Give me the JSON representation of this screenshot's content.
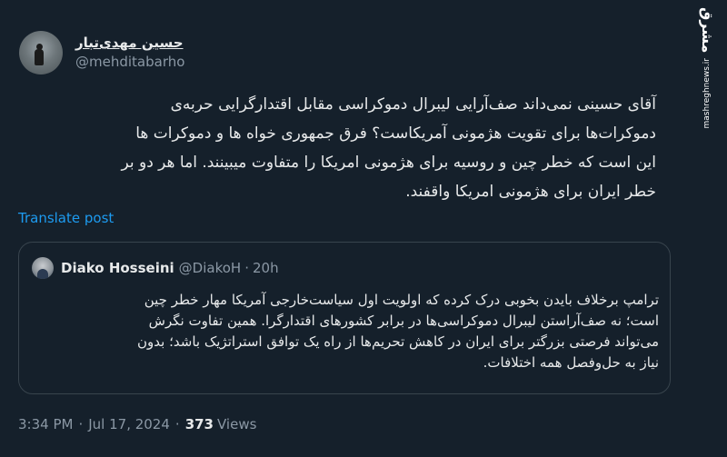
{
  "watermark": {
    "logo": "مشرق",
    "url": "mashreghnews.ir"
  },
  "author": {
    "display_name": "حسین مهدی‌تبار",
    "handle": "@mehditabarho"
  },
  "tweet": {
    "text": "آقای حسینی نمی‌داند صف‌آرایی لیبرال دموکراسی مقابل اقتدارگرایی حربه‌ی\nدموکرات‌ها برای تقویت هژمونی آمریکاست؟ فرق جمهوری خواه ها و دموکرات ها\nاین است که خطر چین و روسیه برای هژمونی امریکا را متفاوت میبینند. اما هر دو بر\nخطر ایران برای هژمونی امریکا واقفند.",
    "translate_label": "Translate post"
  },
  "quote": {
    "display_name": "Diako Hosseini",
    "handle": "@DiakoH",
    "dot": "·",
    "time": "20h",
    "text": "ترامپ برخلاف بایدن بخوبی درک کرده که اولویت اول سیاست‌خارجی آمریکا مهار خطر چین\nاست؛ نه صف‌آراستن لیبرال دموکراسی‌ها در برابر کشورهای اقتدارگرا. همین تفاوت نگرش\nمی‌تواند فرصتی بزرگتر برای ایران در کاهش تحریم‌ها از راه یک توافق استراتژیک باشد؛ بدون\nنیاز به حل‌وفصل همه اختلافات."
  },
  "meta": {
    "time": "3:34 PM",
    "dot1": "·",
    "date": "Jul 17, 2024",
    "dot2": "·",
    "views_count": "373",
    "views_label": "Views"
  },
  "colors": {
    "background": "#15202b",
    "text": "#e7e9ea",
    "secondary": "#8b98a5",
    "link": "#1d9bf0",
    "border": "#38444d"
  }
}
